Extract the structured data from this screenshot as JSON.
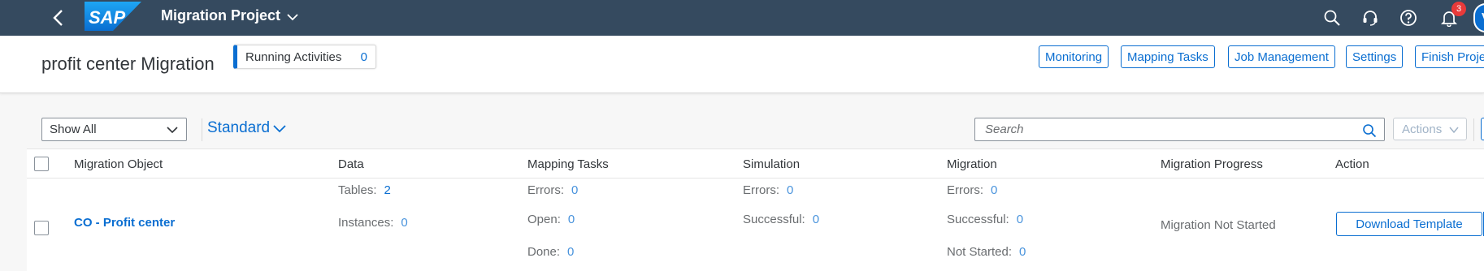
{
  "shell": {
    "app_title": "Migration Project",
    "logo_text": "SAP",
    "notification_count": "3",
    "avatar_initial": "V"
  },
  "header": {
    "page_title": "profit center Migration",
    "running_activities_label": "Running Activities",
    "running_activities_count": "0",
    "buttons": [
      "Monitoring",
      "Mapping Tasks",
      "Job Management",
      "Settings",
      "Finish Proje"
    ]
  },
  "toolbar": {
    "filter_value": "Show All",
    "variant": "Standard",
    "search_placeholder": "Search",
    "actions_label": "Actions"
  },
  "table": {
    "columns": [
      "Migration Object",
      "Data",
      "Mapping Tasks",
      "Simulation",
      "Migration",
      "Migration Progress",
      "Action"
    ],
    "row": {
      "object": "CO - Profit center",
      "data": {
        "tables_label": "Tables:",
        "tables": "2",
        "instances_label": "Instances:",
        "instances": "0"
      },
      "mapping": {
        "errors_label": "Errors:",
        "errors": "0",
        "open_label": "Open:",
        "open": "0",
        "done_label": "Done:",
        "done": "0"
      },
      "simulation": {
        "errors_label": "Errors:",
        "errors": "0",
        "successful_label": "Successful:",
        "successful": "0"
      },
      "migration": {
        "errors_label": "Errors:",
        "errors": "0",
        "successful_label": "Successful:",
        "successful": "0",
        "not_started_label": "Not Started:",
        "not_started": "0"
      },
      "progress": "Migration Not Started",
      "action_button": "Download Template"
    }
  },
  "colors": {
    "shell": "#354a5f",
    "accent": "#0a6ed1",
    "badge": "#e83a3a"
  }
}
